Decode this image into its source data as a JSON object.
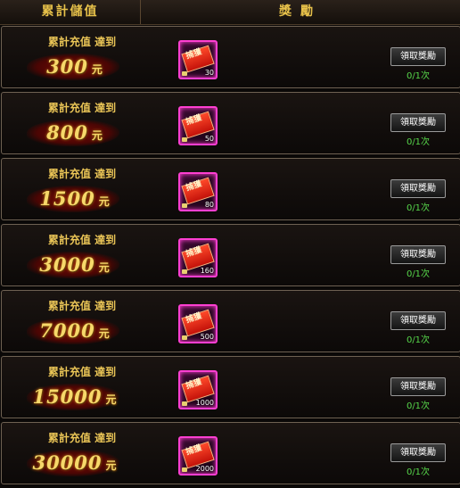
{
  "header": {
    "col1": "累計儲值",
    "col2": "獎勵"
  },
  "rows": [
    {
      "cond": "累計充值 達到",
      "amount": "300",
      "unit": "元",
      "item_label": "捕獲",
      "item_count": "30",
      "button": "領取獎勵",
      "progress": "0/1次"
    },
    {
      "cond": "累計充值 達到",
      "amount": "800",
      "unit": "元",
      "item_label": "捕獲",
      "item_count": "50",
      "button": "領取獎勵",
      "progress": "0/1次"
    },
    {
      "cond": "累計充值 達到",
      "amount": "1500",
      "unit": "元",
      "item_label": "捕獲",
      "item_count": "80",
      "button": "領取獎勵",
      "progress": "0/1次"
    },
    {
      "cond": "累計充值 達到",
      "amount": "3000",
      "unit": "元",
      "item_label": "捕獲",
      "item_count": "160",
      "button": "領取獎勵",
      "progress": "0/1次"
    },
    {
      "cond": "累計充值 達到",
      "amount": "7000",
      "unit": "元",
      "item_label": "捕獲",
      "item_count": "500",
      "button": "領取獎勵",
      "progress": "0/1次"
    },
    {
      "cond": "累計充值 達到",
      "amount": "15000",
      "unit": "元",
      "item_label": "捕獲",
      "item_count": "1000",
      "button": "領取獎勵",
      "progress": "0/1次"
    },
    {
      "cond": "累計充值 達到",
      "amount": "30000",
      "unit": "元",
      "item_label": "捕獲",
      "item_count": "2000",
      "button": "領取獎勵",
      "progress": "0/1次"
    }
  ],
  "colors": {
    "gold": "#e8c24a",
    "item_border": "#ff3fd2",
    "progress": "#56d64a"
  }
}
